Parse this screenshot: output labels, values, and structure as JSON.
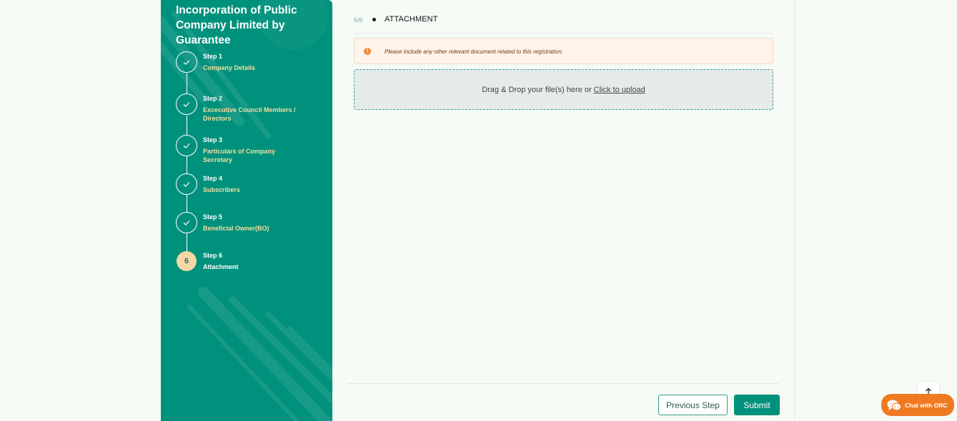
{
  "sidebar": {
    "title": "Incorporation of Public Company Limited by Guarantee",
    "colors": {
      "background": "#00917c",
      "step_name": "#f3dfa0",
      "active_circle": "#f7d7a5"
    },
    "steps": [
      {
        "number": "Step 1",
        "name": "Company Details",
        "status": "completed",
        "icon": "check-icon"
      },
      {
        "number": "Step 2",
        "name": "Excecutive Council Members / Directors",
        "status": "completed",
        "icon": "check-icon"
      },
      {
        "number": "Step 3",
        "name": "Particulars of Company Secretary",
        "status": "completed",
        "icon": "check-icon"
      },
      {
        "number": "Step 4",
        "name": "Subscribers",
        "status": "completed",
        "icon": "check-icon"
      },
      {
        "number": "Step 5",
        "name": "Beneficial Owner(BO)",
        "status": "completed",
        "icon": "check-icon"
      },
      {
        "number": "Step 6",
        "name": "Attachment",
        "status": "active",
        "badge": "6"
      }
    ]
  },
  "main": {
    "counter": "6/6",
    "title": "ATTACHMENT",
    "alert": {
      "icon": "warning-icon",
      "color": "#ee8a3c",
      "message": "Please include any other relevant document related to this registration."
    },
    "dropzone": {
      "text": "Drag & Drop your file(s) here or",
      "link": "Click to upload"
    },
    "buttons": {
      "previous": "Previous Step",
      "submit": "Submit"
    }
  },
  "widgets": {
    "scroll_top_icon": "arrow-up-icon",
    "chat_label": "Chat with ORC",
    "chat_icon": "chat-bubbles-icon",
    "chat_color": "#f07a21"
  }
}
